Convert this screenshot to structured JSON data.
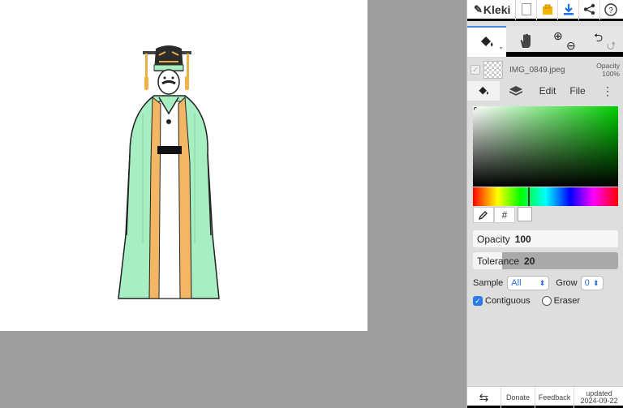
{
  "app": {
    "name": "Kleki"
  },
  "toolbar": {
    "icons": [
      "new-image-icon",
      "save-icon",
      "download-icon",
      "share-icon",
      "help-icon"
    ]
  },
  "tools": [
    "fill-bucket-icon",
    "hand-icon",
    "zoom-in-icon",
    "zoom-out-icon",
    "undo-icon",
    "redo-icon"
  ],
  "layer": {
    "name": "IMG_0849.jpeg",
    "opacity_label": "Opacity",
    "opacity_value": "100%"
  },
  "tabs": {
    "edit": "Edit",
    "file": "File"
  },
  "color": {
    "hex_label": "#",
    "selected": "#ffffff",
    "hue_fraction": 0.38
  },
  "fill_settings": {
    "opacity_label": "Opacity",
    "opacity_value": "100",
    "opacity_fraction": 1.0,
    "tolerance_label": "Tolerance",
    "tolerance_value": "20",
    "tolerance_fraction": 0.2,
    "sample_label": "Sample",
    "sample_value": "All",
    "grow_label": "Grow",
    "grow_value": "0",
    "contiguous_label": "Contiguous",
    "contiguous_checked": true,
    "eraser_label": "Eraser",
    "eraser_checked": false
  },
  "footer": {
    "donate": "Donate",
    "feedback": "Feedback",
    "updated_label": "updated",
    "updated_date": "2024-09-22"
  }
}
